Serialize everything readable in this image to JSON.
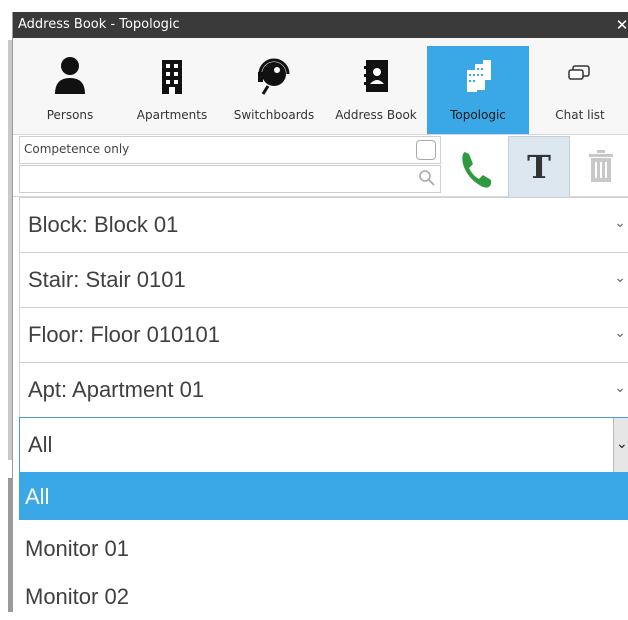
{
  "window": {
    "title": "Address Book - Topologic"
  },
  "tabs": [
    {
      "label": "Persons",
      "icon": "person-icon"
    },
    {
      "label": "Apartments",
      "icon": "building-icon"
    },
    {
      "label": "Switchboards",
      "icon": "headset-icon"
    },
    {
      "label": "Address Book",
      "icon": "address-book-icon"
    },
    {
      "label": "Topologic",
      "icon": "buildings-icon",
      "active": true
    },
    {
      "label": "Chat list",
      "icon": "chat-icon"
    }
  ],
  "search": {
    "competence_label": "Competence only",
    "search_value": ""
  },
  "filters": {
    "block": "Block: Block 01",
    "stair": "Stair: Stair 0101",
    "floor": "Floor: Floor 010101",
    "apt": "Apt: Apartment 01",
    "device_selected": "All"
  },
  "device_options": [
    "All",
    "Monitor 01",
    "Monitor 02"
  ],
  "colors": {
    "accent": "#3aa8e6",
    "phone_green": "#2e9a3e",
    "titlebar": "#3a3a3a"
  }
}
